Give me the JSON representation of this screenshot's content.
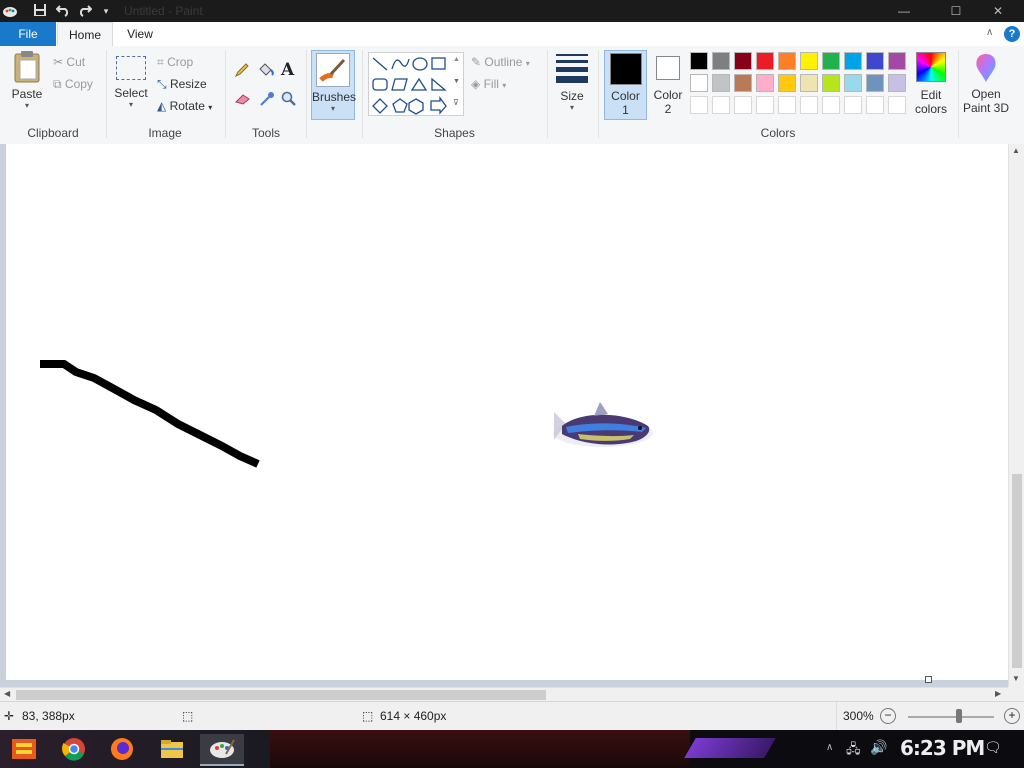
{
  "window": {
    "title": "Untitled - Paint",
    "minimize": "—",
    "maximize": "☐",
    "close": "✕"
  },
  "tabs": {
    "file": "File",
    "home": "Home",
    "view": "View"
  },
  "ribbon": {
    "clipboard": {
      "paste": "Paste",
      "cut": "Cut",
      "copy": "Copy",
      "label": "Clipboard"
    },
    "image": {
      "select": "Select",
      "crop": "Crop",
      "resize": "Resize",
      "rotate": "Rotate",
      "label": "Image"
    },
    "tools": {
      "label": "Tools",
      "text_glyph": "A"
    },
    "brushes": {
      "label": "Brushes"
    },
    "shapes": {
      "outline": "Outline",
      "fill": "Fill",
      "label": "Shapes"
    },
    "size": {
      "label": "Size"
    },
    "colors": {
      "color1": "Color",
      "color1_num": "1",
      "color2": "Color",
      "color2_num": "2",
      "edit_line1": "Edit",
      "edit_line2": "colors",
      "label": "Colors",
      "palette_row1": [
        "#000000",
        "#7f7f7f",
        "#880015",
        "#ed1c24",
        "#ff7f27",
        "#fff200",
        "#22b14c",
        "#00a2e8",
        "#3f48cc",
        "#a349a4"
      ],
      "palette_row2": [
        "#ffffff",
        "#c3c3c3",
        "#b97a57",
        "#ffaec9",
        "#ffc90e",
        "#efe4b0",
        "#b5e61d",
        "#99d9ea",
        "#7092be",
        "#c8bfe7"
      ],
      "color1_value": "#000000",
      "color2_value": "#ffffff"
    },
    "paint3d": {
      "line1": "Open",
      "line2": "Paint 3D"
    }
  },
  "status": {
    "cursor": "83, 388px",
    "canvas_size": "614 × 460px",
    "zoom": "300%"
  },
  "taskbar": {
    "clock": "6:23 PM"
  }
}
